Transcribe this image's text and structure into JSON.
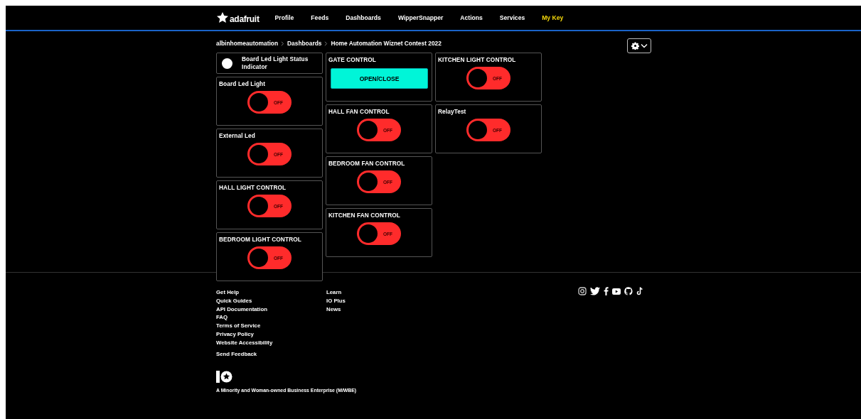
{
  "nav": {
    "brand": "adafruit",
    "items": [
      {
        "label": "Profile",
        "highlighted": false
      },
      {
        "label": "Feeds",
        "highlighted": false
      },
      {
        "label": "Dashboards",
        "highlighted": false
      },
      {
        "label": "WipperSnapper",
        "highlighted": false
      },
      {
        "label": "Actions",
        "highlighted": false
      },
      {
        "label": "Services",
        "highlighted": false
      },
      {
        "label": "My Key",
        "highlighted": true
      }
    ]
  },
  "breadcrumb": [
    "albinhomeautomation",
    "Dashboards",
    "Home Automation Wiznet Contest 2022"
  ],
  "dashboard": {
    "columns": [
      [
        {
          "kind": "indicator",
          "title": "Board Led Light Status Indicator"
        },
        {
          "kind": "toggle",
          "title": "Board Led Light",
          "label": "OFF",
          "on": false
        },
        {
          "kind": "toggle",
          "title": "External Led",
          "label": "OFF",
          "on": false
        },
        {
          "kind": "toggle",
          "title": "HALL LIGHT CONTROL",
          "label": "OFF",
          "on": false
        },
        {
          "kind": "toggle",
          "title": "BEDROOM LIGHT CONTROL",
          "label": "OFF",
          "on": false
        }
      ],
      [
        {
          "kind": "button",
          "title": "GATE CONTROL",
          "label": "OPEN/CLOSE"
        },
        {
          "kind": "toggle",
          "title": "HALL FAN CONTROL",
          "label": "OFF",
          "on": false
        },
        {
          "kind": "toggle",
          "title": "BEDROOM FAN CONTROL",
          "label": "OFF",
          "on": false
        },
        {
          "kind": "toggle",
          "title": "KITCHEN FAN CONTROL",
          "label": "OFF",
          "on": false
        }
      ],
      [
        {
          "kind": "toggle",
          "title": "KITCHEN LIGHT CONTROL",
          "label": "OFF",
          "on": false
        },
        {
          "kind": "toggle",
          "title": "RelayTest",
          "label": "OFF",
          "on": false
        }
      ]
    ]
  },
  "footer": {
    "links_1": [
      "Get Help",
      "Quick Guides",
      "API Documentation",
      "FAQ",
      "Terms of Service",
      "Privacy Policy",
      "Website Accessibility"
    ],
    "feedback": "Send Feedback",
    "links_2": [
      "Learn",
      "IO Plus",
      "News"
    ],
    "tagline": "A Minority and Woman-owned Business Enterprise (M/WBE)"
  }
}
